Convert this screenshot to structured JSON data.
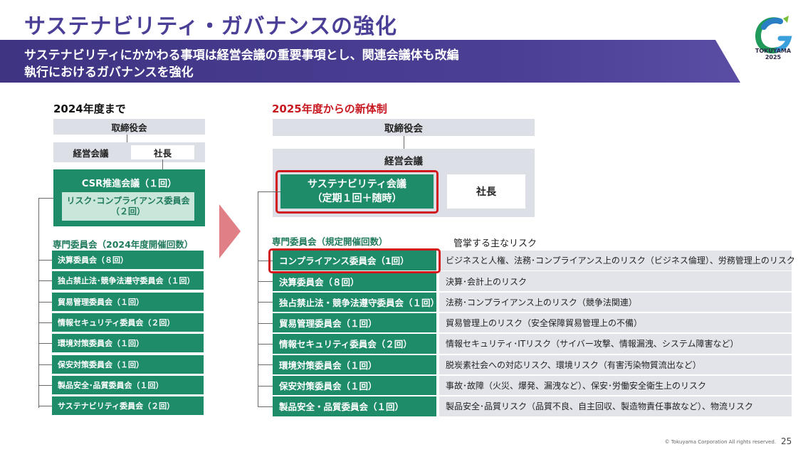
{
  "title": "サステナビリティ・ガバナンスの強化",
  "banner": {
    "line1": "サステナビリティにかかわる事項は経営会議の重要事項とし、関連会議体も改編",
    "line2": "執行におけるガバナンスを強化"
  },
  "logo": {
    "name": "TOKUYAMA",
    "year": "2025"
  },
  "left": {
    "heading": "2024年度まで",
    "board": "取締役会",
    "mgmt": "経営会議",
    "president": "社長",
    "csr": "CSR推進会議（１回）",
    "risk_committee_line1": "リスク･コンプライアンス委員会",
    "risk_committee_line2": "（２回）",
    "section_label": "専門委員会（2024年度開催回数）",
    "committees": [
      "決算委員会（８回）",
      "独占禁止法･競争法遵守委員会（１回）",
      "貿易管理委員会（１回）",
      "情報セキュリティ委員会（２回）",
      "環境対策委員会（１回）",
      "保安対策委員会（１回）",
      "製品安全･品質委員会（１回）",
      "サステナビリティ委員会（２回）"
    ]
  },
  "right": {
    "heading": "2025年度からの新体制",
    "board": "取締役会",
    "mgmt": "経営会議",
    "sustain_line1": "サステナビリティ会議",
    "sustain_line2": "（定期１回＋随時）",
    "president": "社長",
    "section_label": "専門委員会（規定開催回数）",
    "risk_header": "管掌する主なリスク",
    "committees": [
      {
        "name": "コンプライアンス委員会（1回）",
        "risk": "ビジネスと人権、法務･コンプライアンス上のリスク（ビジネス倫理）、労務管理上のリスク"
      },
      {
        "name": "決算委員会（８回）",
        "risk": "決算･会計上のリスク"
      },
      {
        "name": "独占禁止法・競争法遵守委員会（１回）",
        "risk": "法務･コンプライアンス上のリスク（競争法関連）"
      },
      {
        "name": "貿易管理委員会（１回）",
        "risk": "貿易管理上のリスク（安全保障貿易管理上の不備）"
      },
      {
        "name": "情報セキュリティ委員会（２回）",
        "risk": "情報セキュリティ･ITリスク（サイバー攻撃、情報漏洩、システム障害など）"
      },
      {
        "name": "環境対策委員会（１回）",
        "risk": "脱炭素社会への対応リスク、環境リスク（有害汚染物質流出など）"
      },
      {
        "name": "保安対策委員会（１回）",
        "risk": "事故･故障（火災、爆発、漏洩など）、保安･労働安全衛生上のリスク"
      },
      {
        "name": "製品安全・品質委員会（１回）",
        "risk": "製品安全･品質リスク（品質不良、自主回収、製造物責任事故など）、物流リスク"
      }
    ]
  },
  "footer": "© Tokuyama Corporation All rights reserved.",
  "page_number": "25",
  "colors": {
    "purple": "#4a3f96",
    "green": "#1f8c69",
    "red": "#d0181d",
    "gray": "#dcdfe6"
  }
}
